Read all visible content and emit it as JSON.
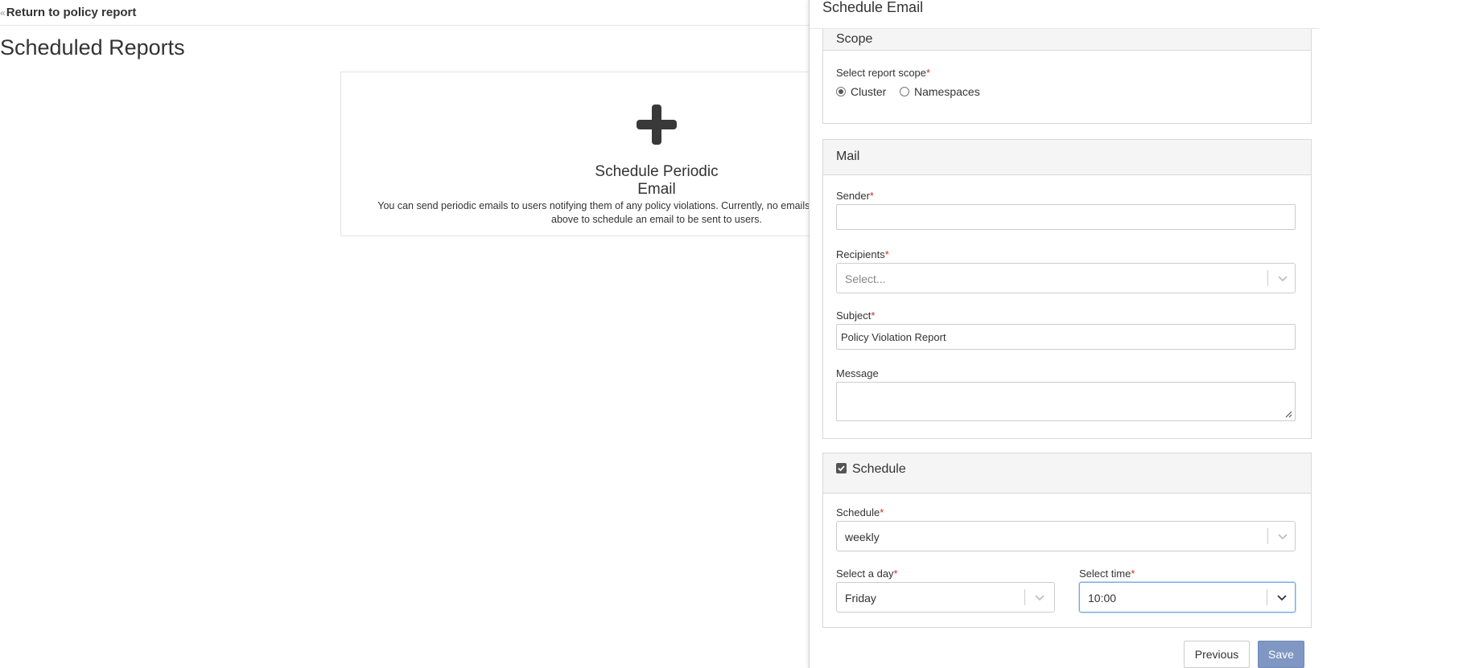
{
  "nav": {
    "back_link": "Return to policy report"
  },
  "page": {
    "title": "Scheduled Reports"
  },
  "empty_state": {
    "title": "Schedule Periodic Email",
    "description": "You can send periodic emails to users notifying them of any policy violations. Currently, no emails have been scheduled. Click above to schedule an email to be sent to users."
  },
  "drawer": {
    "title": "Schedule Email",
    "scope": {
      "header": "Scope",
      "label": "Select report scope",
      "options": [
        "Cluster",
        "Namespaces"
      ],
      "selected": "Cluster"
    },
    "mail": {
      "header": "Mail",
      "sender_label": "Sender",
      "sender_value": "",
      "recipients_label": "Recipients",
      "recipients_placeholder": "Select...",
      "subject_label": "Subject",
      "subject_value": "Policy Violation Report",
      "message_label": "Message",
      "message_value": ""
    },
    "schedule": {
      "header": "Schedule",
      "enabled": true,
      "schedule_label": "Schedule",
      "schedule_value": "weekly",
      "day_label": "Select a day",
      "day_value": "Friday",
      "time_label": "Select time",
      "time_value": "10:00"
    },
    "buttons": {
      "previous": "Previous",
      "save": "Save"
    }
  },
  "required_marker": "*"
}
